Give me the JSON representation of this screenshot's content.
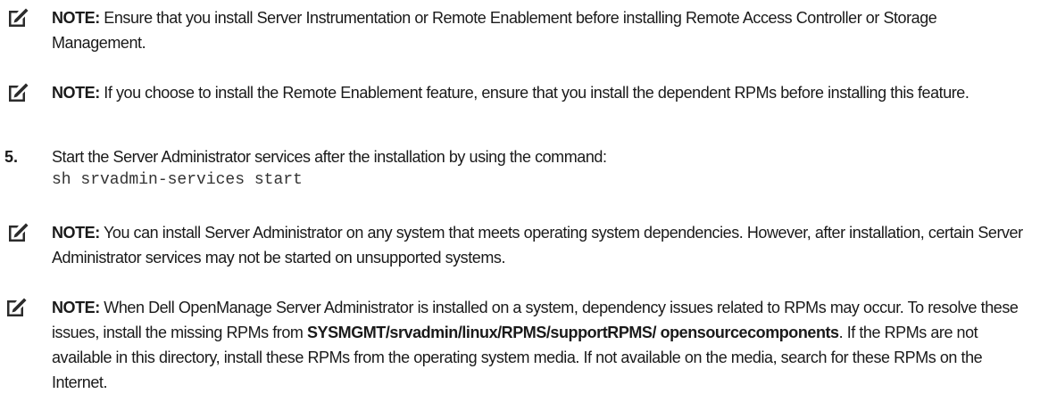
{
  "notes": [
    {
      "label": "NOTE:",
      "text": " Ensure that you install Server Instrumentation or Remote Enablement before installing Remote Access Controller or Storage Management."
    },
    {
      "label": "NOTE:",
      "text": " If you choose to install the Remote Enablement feature, ensure that you install the dependent RPMs before installing this feature."
    },
    {
      "label": "NOTE:",
      "text": " You can install Server Administrator on any system that meets operating system dependencies. However, after installation, certain Server Administrator services may not be started on unsupported systems."
    },
    {
      "label": "NOTE:",
      "text_before": " When Dell OpenManage Server Administrator is installed on a system, dependency issues related to RPMs may occur. To resolve these issues, install the missing RPMs from ",
      "path": "SYSMGMT/srvadmin/linux/RPMS/supportRPMS/ opensourcecomponents",
      "text_after": ". If the RPMs are not available in this directory, install these RPMs from the operating system media. If not available on the media, search for these RPMs on the Internet."
    }
  ],
  "step": {
    "number": "5.",
    "text": "Start the Server Administrator services after the installation by using the command:",
    "command": "sh srvadmin-services start"
  },
  "icon": "pencil-note-icon"
}
